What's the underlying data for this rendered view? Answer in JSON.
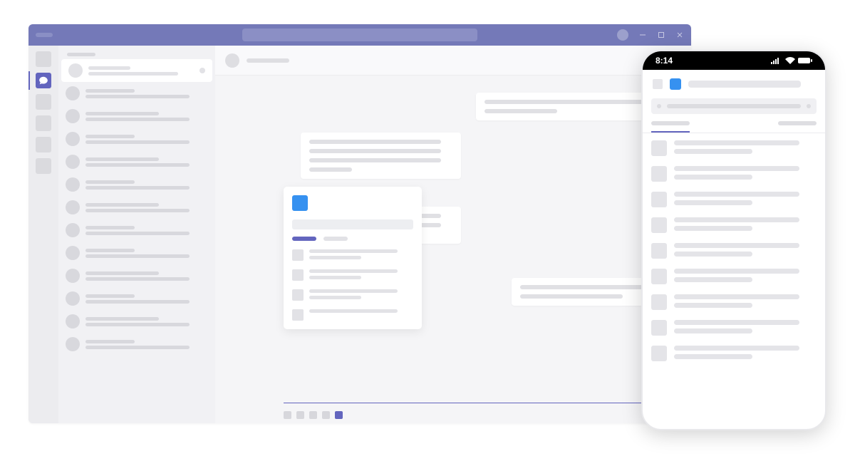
{
  "colors": {
    "accent_purple": "#6365be",
    "titlebar_purple": "#7479b8",
    "icon_blue": "#3691f0"
  },
  "desktop": {
    "titlebar": {
      "search_placeholder": "",
      "window_controls": [
        "minimize",
        "maximize",
        "close"
      ]
    },
    "rail": {
      "items": [
        {
          "id": "activity",
          "active": false
        },
        {
          "id": "chat",
          "active": true,
          "icon": "chat-bubble"
        },
        {
          "id": "teams",
          "active": false
        },
        {
          "id": "calendar",
          "active": false
        },
        {
          "id": "calls",
          "active": false
        },
        {
          "id": "files",
          "active": false
        }
      ]
    },
    "chatlist": {
      "header": "",
      "items": [
        {
          "selected": true
        },
        {
          "selected": false
        },
        {
          "selected": false
        },
        {
          "selected": false
        },
        {
          "selected": false
        },
        {
          "selected": false
        },
        {
          "selected": false
        },
        {
          "selected": false
        },
        {
          "selected": false
        },
        {
          "selected": false
        },
        {
          "selected": false
        },
        {
          "selected": false
        },
        {
          "selected": false
        }
      ]
    },
    "conversation": {
      "header_name": "",
      "messages": [
        {
          "side": "right",
          "lines": 2
        },
        {
          "side": "left",
          "lines": 4
        },
        {
          "side": "left",
          "lines": 3
        },
        {
          "side": "right",
          "lines": 2
        }
      ],
      "composer": {
        "icons": 5,
        "selected_index": 4
      }
    },
    "popup": {
      "app_icon": "blue-square",
      "search_placeholder": "",
      "tabs": [
        {
          "active": true,
          "label": ""
        },
        {
          "active": false,
          "label": ""
        }
      ],
      "results": [
        {
          "thumb": true,
          "lines": 2
        },
        {
          "thumb": true,
          "lines": 2
        },
        {
          "thumb": true,
          "lines": 2
        },
        {
          "thumb": true,
          "lines": 1
        }
      ]
    }
  },
  "mobile": {
    "status": {
      "time": "8:14",
      "signal": "full",
      "wifi": "full",
      "battery": "full"
    },
    "header": {
      "app_icon": "blue-square",
      "title": ""
    },
    "search": {
      "placeholder": ""
    },
    "tabs": [
      {
        "active": true,
        "label": ""
      },
      {
        "active": false,
        "label": ""
      }
    ],
    "results": [
      {
        "lines": 2
      },
      {
        "lines": 2
      },
      {
        "lines": 2
      },
      {
        "lines": 2
      },
      {
        "lines": 2
      },
      {
        "lines": 2
      },
      {
        "lines": 2
      },
      {
        "lines": 2
      },
      {
        "lines": 2
      }
    ]
  }
}
